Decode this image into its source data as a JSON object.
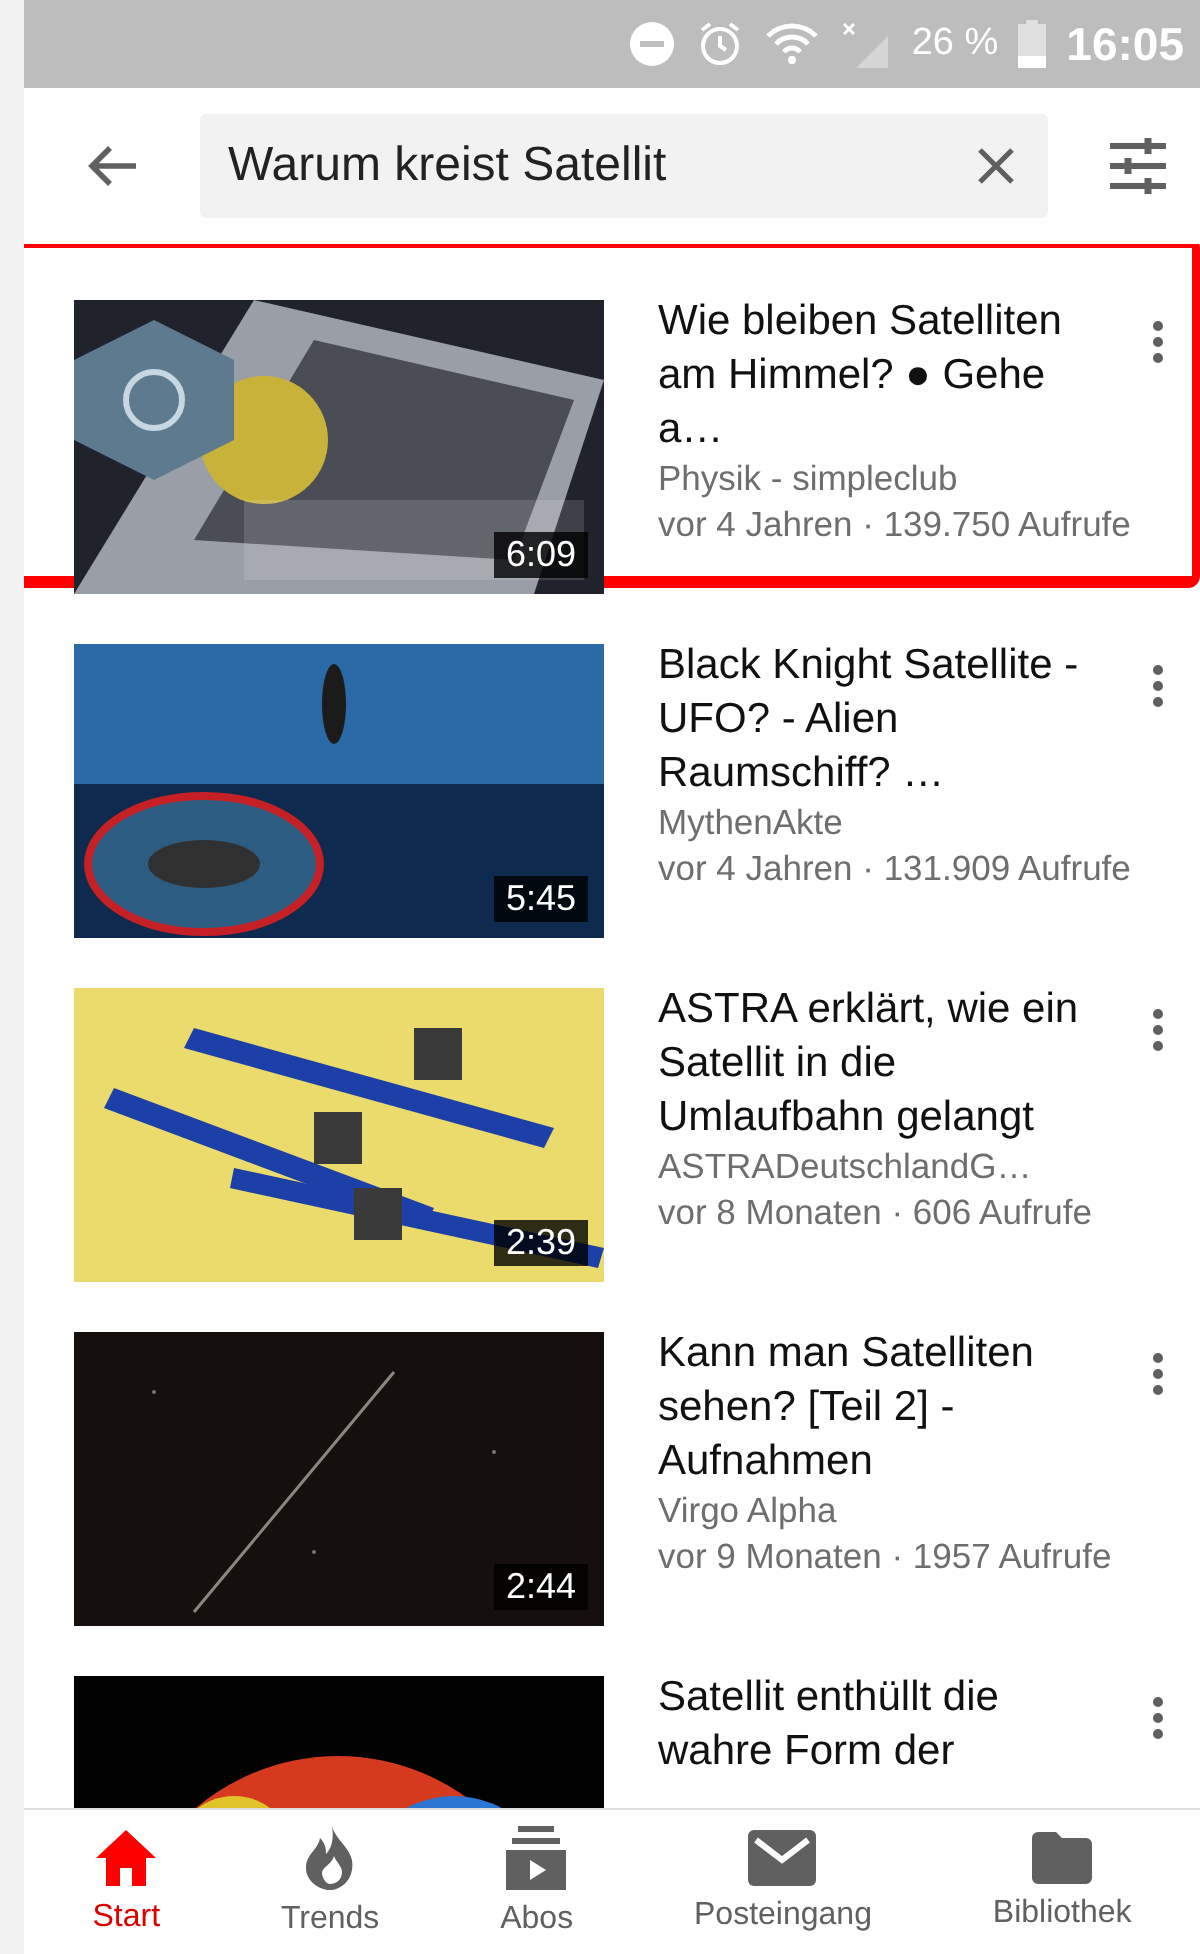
{
  "status_bar": {
    "battery": "26 %",
    "time": "16:05"
  },
  "search": {
    "value": "Warum kreist Satellit"
  },
  "results": [
    {
      "title": "Wie bleiben Satelliten am Himmel? ● Gehe a…",
      "channel": "Physik - simpleclub",
      "meta": "vor 4 Jahren · 139.750 Aufrufe",
      "duration": "6:09",
      "highlighted": true
    },
    {
      "title": "Black Knight Satellite - UFO? - Alien Raumschiff? …",
      "channel": "MythenAkte",
      "meta": "vor 4 Jahren · 131.909 Aufrufe",
      "duration": "5:45",
      "highlighted": false
    },
    {
      "title": "ASTRA erklärt, wie ein Satellit in die Umlaufbahn gelangt",
      "channel": "ASTRADeutschlandG…",
      "meta": "vor 8 Monaten · 606 Aufrufe",
      "duration": "2:39",
      "highlighted": false
    },
    {
      "title": "Kann man Satelliten sehen? [Teil 2] - Aufnahmen",
      "channel": "Virgo Alpha",
      "meta": "vor 9 Monaten · 1957 Aufrufe",
      "duration": "2:44",
      "highlighted": false
    },
    {
      "title": "Satellit enthüllt die wahre Form der",
      "highlighted": false
    }
  ],
  "nav": [
    {
      "label": "Start",
      "selected": true
    },
    {
      "label": "Trends",
      "selected": false
    },
    {
      "label": "Abos",
      "selected": false
    },
    {
      "label": "Posteingang",
      "selected": false
    },
    {
      "label": "Bibliothek",
      "selected": false
    }
  ]
}
